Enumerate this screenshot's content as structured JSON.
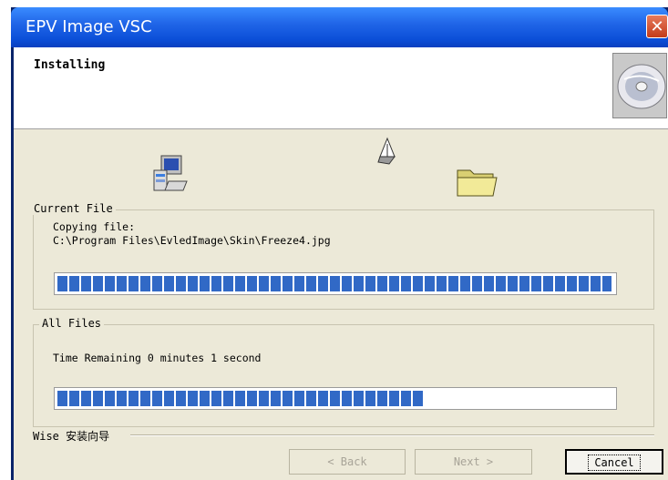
{
  "window": {
    "title": "EPV Image VSC",
    "close_glyph": "✕"
  },
  "header": {
    "title": "Installing",
    "icon": "cd-disc-icon"
  },
  "icons": {
    "source": "computer-icon",
    "transfer": "flying-document-icon",
    "destination": "folder-icon"
  },
  "current_file": {
    "legend": "Current File",
    "line1": "Copying file:",
    "line2": "C:\\Program Files\\EvledImage\\Skin\\Freeze4.jpg",
    "progress": 1.0
  },
  "all_files": {
    "legend": "All Files",
    "status": "Time Remaining 0 minutes 1 second",
    "progress": 0.66
  },
  "footer": {
    "brand": "Wise 安装向导",
    "back_label": "< Back",
    "next_label": "Next >",
    "cancel_label": "Cancel"
  },
  "colors": {
    "titlebar": "#2166e8",
    "progress": "#3169c6",
    "panel": "#ece9d8"
  }
}
